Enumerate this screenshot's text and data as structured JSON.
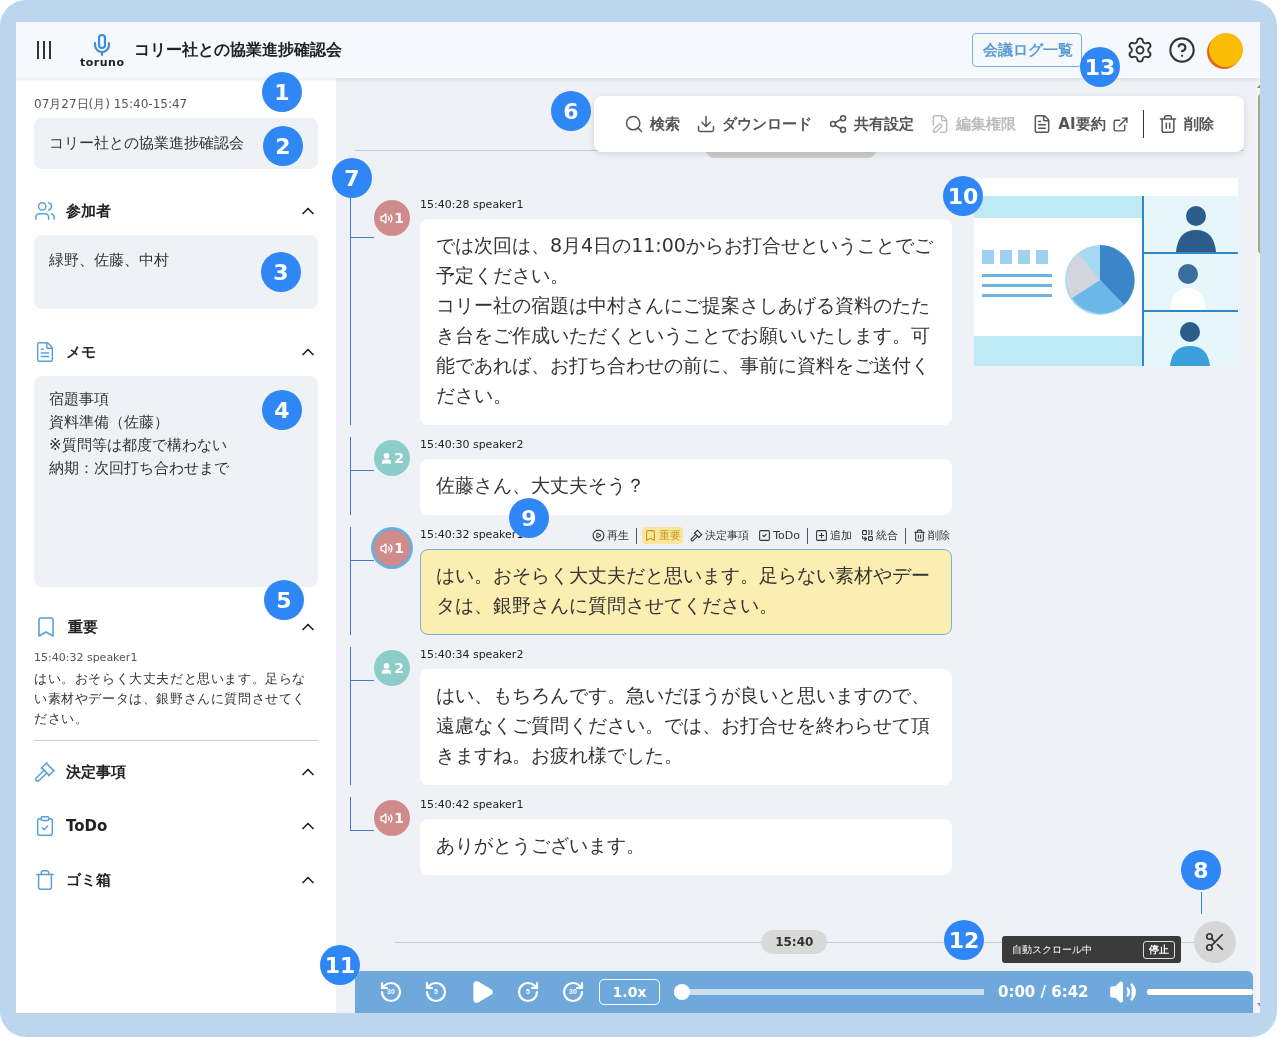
{
  "header": {
    "logo_text": "toruno",
    "title": "コリー社との協業進捗確認会",
    "log_button": "会議ログ一覧"
  },
  "sidebar": {
    "date": "07月27日(月) 15:40-15:47",
    "meeting_title": "コリー社との協業進捗確認会",
    "sections": [
      {
        "kind": "participants",
        "title": "参加者",
        "expanded": true,
        "text": "緑野、佐藤、中村"
      },
      {
        "kind": "memo",
        "title": "メモ",
        "expanded": true,
        "lines": [
          "宿題事項",
          "資料準備（佐藤）",
          "※質問等は都度で構わない",
          "納期：次回打ち合わせまで"
        ]
      },
      {
        "kind": "important",
        "title": "重要",
        "expanded": true,
        "items": [
          {
            "time": "15:40:32 speaker1",
            "text": "はい。おそらく大丈夫だと思います。足らない素材やデータは、銀野さんに質問させてください。"
          }
        ]
      },
      {
        "kind": "decisions",
        "title": "決定事項",
        "expanded": true
      },
      {
        "kind": "todo",
        "title": "ToDo",
        "expanded": true
      },
      {
        "kind": "trash",
        "title": "ゴミ箱",
        "expanded": true
      }
    ]
  },
  "toolbar": {
    "groups": [
      [
        {
          "kind": "search",
          "label": "検索",
          "disabled": false
        },
        {
          "kind": "download",
          "label": "ダウンロード",
          "disabled": false
        },
        {
          "kind": "share",
          "label": "共有設定",
          "disabled": false
        },
        {
          "kind": "permission",
          "label": "編集権限",
          "disabled": true
        },
        {
          "kind": "ai",
          "label": "AI要約",
          "disabled": false,
          "external": true
        }
      ],
      [
        {
          "kind": "delete",
          "label": "削除",
          "disabled": false
        }
      ]
    ]
  },
  "messages": [
    {
      "time": "15:40:28 speaker1",
      "avatar": {
        "kind": "voice",
        "number": "1",
        "color": "#d08b8b"
      },
      "selected": false,
      "important": false,
      "paragraphs": [
        "では次回は、8月4日の11:00からお打合せということでご予定ください。",
        "コリー社の宿題は中村さんにご提案さしあげる資料のたたき台をご作成いただくということでお願いいたします。可能であれば、お打ち合わせの前に、事前に資料をご送付ください。"
      ]
    },
    {
      "time": "15:40:30 speaker2",
      "avatar": {
        "kind": "person",
        "number": "2",
        "color": "#8ccdca"
      },
      "selected": false,
      "important": false,
      "text": "佐藤さん、大丈夫そう？"
    },
    {
      "time": "15:40:32 speaker1",
      "avatar": {
        "kind": "voice",
        "number": "1",
        "color": "#d08b8b"
      },
      "selected": true,
      "important": true,
      "text": "はい。おそらく大丈夫だと思います。足らない素材やデータは、銀野さんに質問させてください。",
      "actions": [
        [
          {
            "kind": "play",
            "label": "再生",
            "active": false
          }
        ],
        [
          {
            "kind": "important",
            "label": "重要",
            "active": true
          },
          {
            "kind": "decision",
            "label": "決定事項",
            "active": false
          },
          {
            "kind": "todo",
            "label": "ToDo",
            "active": false
          }
        ],
        [
          {
            "kind": "add",
            "label": "追加",
            "active": false
          },
          {
            "kind": "merge",
            "label": "統合",
            "active": false
          }
        ],
        [
          {
            "kind": "delete",
            "label": "削除",
            "active": false
          }
        ]
      ]
    },
    {
      "time": "15:40:34 speaker2",
      "avatar": {
        "kind": "person",
        "number": "2",
        "color": "#8ccdca"
      },
      "selected": false,
      "important": false,
      "text": "はい、もちろんです。急いだほうが良いと思いますので、遠慮なくご質問ください。では、お打合せを終わらせて頂きますね。お疲れ様でした。"
    },
    {
      "time": "15:40:42 speaker1",
      "avatar": {
        "kind": "voice",
        "number": "1",
        "color": "#d08b8b"
      },
      "selected": false,
      "important": false,
      "text": "ありがとうございます。"
    }
  ],
  "timeline": {
    "chip": "15:40",
    "auto_scroll": {
      "text": "自動スクロール中",
      "button": "停止"
    }
  },
  "player": {
    "buttons": [
      {
        "kind": "back",
        "label": "30"
      },
      {
        "kind": "back",
        "label": "5"
      },
      {
        "kind": "play"
      },
      {
        "kind": "forward",
        "label": "5"
      },
      {
        "kind": "forward",
        "label": "30"
      }
    ],
    "speed": "1.0x",
    "seek": {
      "level": 0
    },
    "time": "0:00 / 6:42",
    "volume": {
      "level": 1
    }
  },
  "callouts": [
    {
      "label": "1"
    },
    {
      "label": "2"
    },
    {
      "label": "3"
    },
    {
      "label": "4"
    },
    {
      "label": "5"
    },
    {
      "label": "6"
    },
    {
      "label": "7"
    },
    {
      "label": "8"
    },
    {
      "label": "9"
    },
    {
      "label": "10"
    },
    {
      "label": "11"
    },
    {
      "label": "12"
    },
    {
      "label": "13"
    }
  ]
}
